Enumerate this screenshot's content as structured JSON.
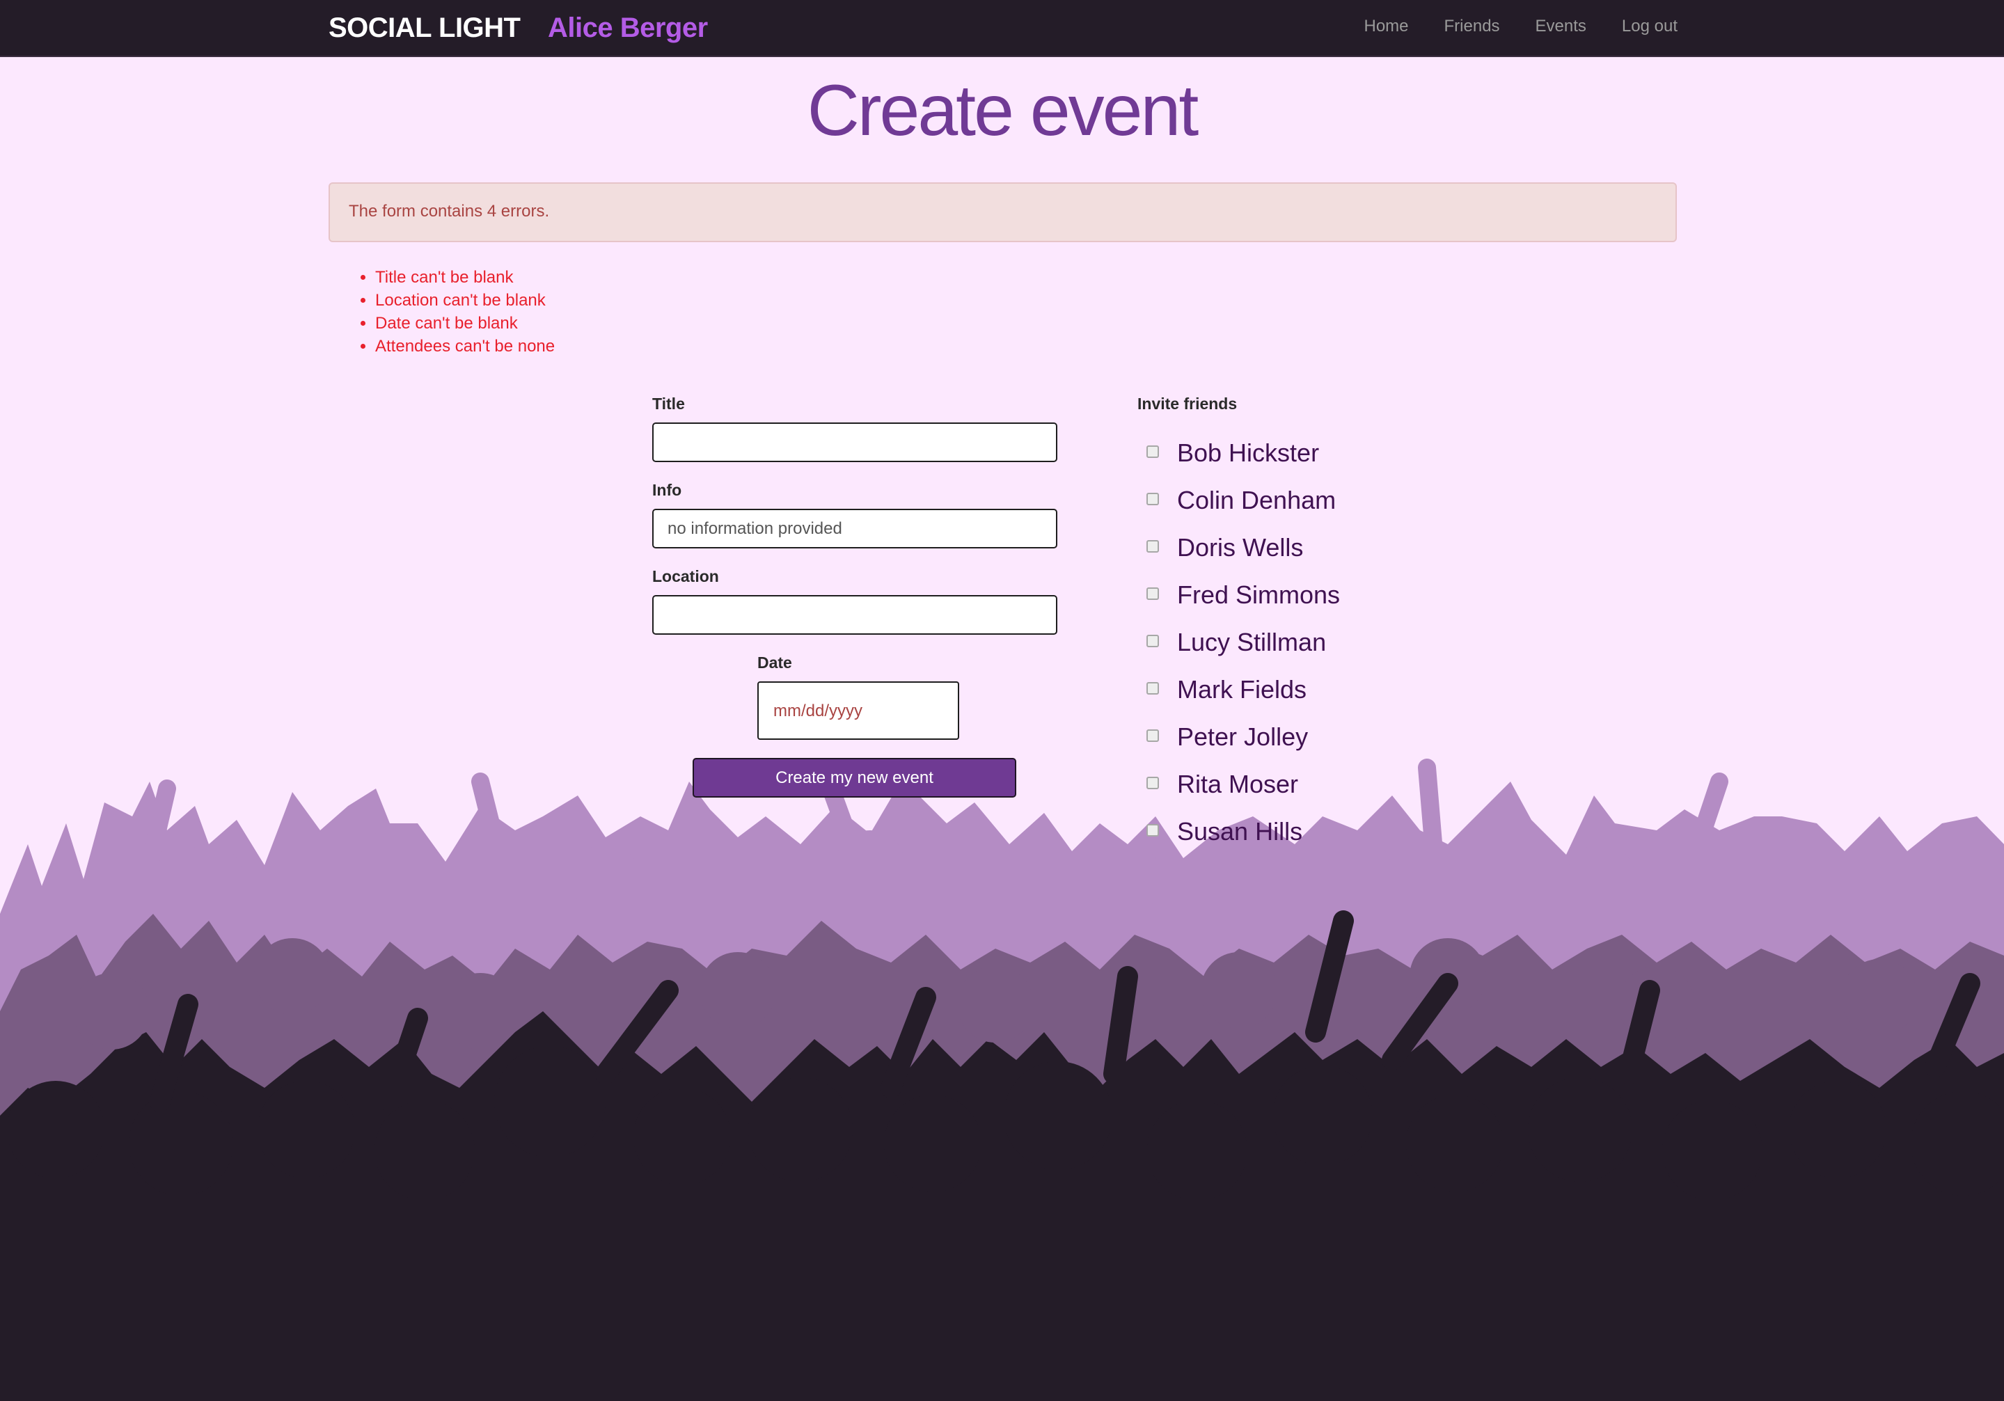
{
  "navbar": {
    "brand": "SOCIAL LIGHT",
    "current_user": "Alice Berger",
    "links": [
      "Home",
      "Friends",
      "Events",
      "Log out"
    ]
  },
  "page": {
    "title": "Create event"
  },
  "errors": {
    "summary": "The form contains 4 errors.",
    "items": [
      "Title can't be blank",
      "Location can't be blank",
      "Date can't be blank",
      "Attendees can't be none"
    ]
  },
  "form": {
    "title_label": "Title",
    "title_value": "",
    "info_label": "Info",
    "info_value": "no information provided",
    "location_label": "Location",
    "location_value": "",
    "date_label": "Date",
    "date_placeholder": "mm/dd/yyyy",
    "submit_label": "Create my new event"
  },
  "invite": {
    "label": "Invite friends",
    "friends": [
      {
        "name": "Bob Hickster",
        "checked": false
      },
      {
        "name": "Colin Denham",
        "checked": false
      },
      {
        "name": "Doris Wells",
        "checked": false
      },
      {
        "name": "Fred Simmons",
        "checked": false
      },
      {
        "name": "Lucy Stillman",
        "checked": false
      },
      {
        "name": "Mark Fields",
        "checked": false
      },
      {
        "name": "Peter Jolley",
        "checked": false
      },
      {
        "name": "Rita Moser",
        "checked": false
      },
      {
        "name": "Susan Hills",
        "checked": false
      }
    ]
  },
  "colors": {
    "page_background": "#fce8fe",
    "navbar": "#241c28",
    "accent": "#703a95",
    "user_name": "#b45ce6",
    "error_text": "#e8202c",
    "crowd_light": "#b48cc4",
    "crowd_mid": "#7a5c84",
    "crowd_dark": "#241c28"
  }
}
